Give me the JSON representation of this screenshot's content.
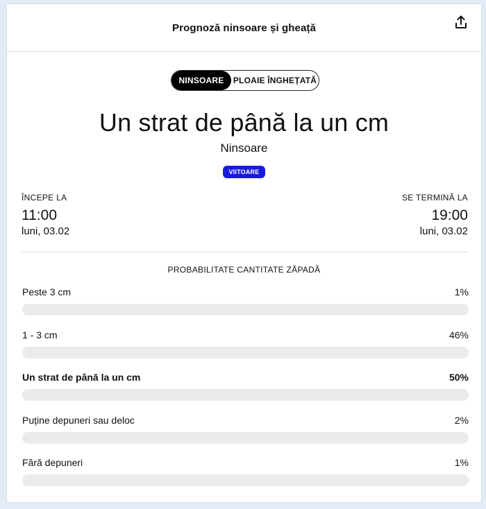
{
  "header": {
    "title": "Prognoză ninsoare și gheață",
    "share_icon": "share-icon"
  },
  "toggle": {
    "options": [
      {
        "label": "NINSOARE",
        "active": true
      },
      {
        "label": "PLOAIE ÎNGHEȚATĂ",
        "active": false
      }
    ]
  },
  "forecast": {
    "title": "Un strat de până la un cm",
    "type": "Ninsoare",
    "badge": "VIITOARE",
    "badge_color": "#1a1adf"
  },
  "start": {
    "label": "ÎNCEPE LA",
    "time": "11:00",
    "date": "luni, 03.02"
  },
  "end": {
    "label": "SE TERMINĂ LA",
    "time": "19:00",
    "date": "luni, 03.02"
  },
  "probability": {
    "heading": "PROBABILITATE CANTITATE ZĂPADĂ",
    "items": [
      {
        "label": "Peste 3 cm",
        "percent_text": "1%",
        "value": 1,
        "highlight": false
      },
      {
        "label": "1 - 3 cm",
        "percent_text": "46%",
        "value": 46,
        "highlight": false
      },
      {
        "label": "Un strat de până la un cm",
        "percent_text": "50%",
        "value": 50,
        "highlight": true
      },
      {
        "label": "Puține depuneri sau deloc",
        "percent_text": "2%",
        "value": 2,
        "highlight": false
      },
      {
        "label": "Fără depuneri",
        "percent_text": "1%",
        "value": 1,
        "highlight": false
      }
    ]
  }
}
